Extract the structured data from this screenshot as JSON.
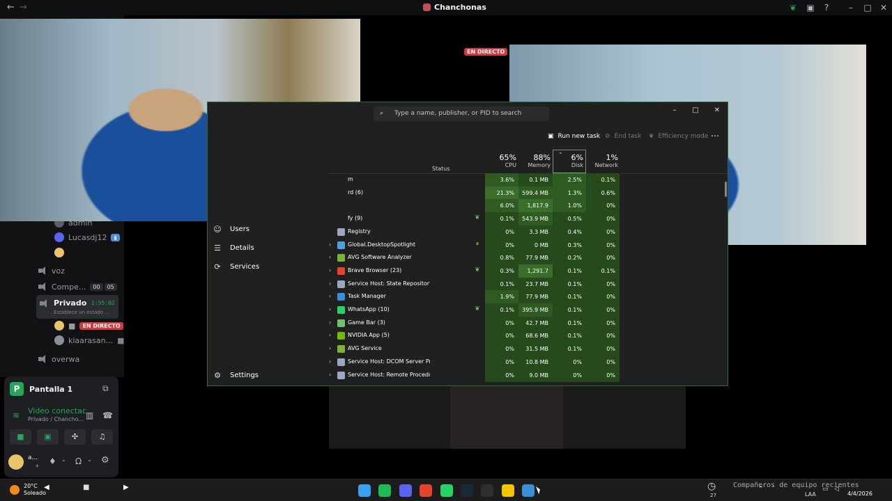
{
  "topbar": {
    "title": "Chanchonas",
    "back_icon": "arrow-left-icon",
    "forward_icon": "arrow-right-icon"
  },
  "channels": {
    "members": [
      {
        "name": "admin"
      },
      {
        "name": "Lucasdj12"
      }
    ],
    "voice_channels": [
      {
        "name": "voz"
      },
      {
        "name": "Compe...",
        "counter_a": "00",
        "counter_b": "05"
      },
      {
        "name": "Privado",
        "timer": "1:55:02",
        "status": "Establece un estado ..."
      },
      {
        "name": "overwa"
      }
    ],
    "privado_members": [
      {
        "name": "",
        "badge": "EN DIRECTO"
      },
      {
        "name": "kiaarasan..."
      }
    ]
  },
  "voice_panel": {
    "logo_letter": "P",
    "title": "Pantalla 1",
    "connection": "Video conectac",
    "location": "Privado / Chancho..."
  },
  "user_bar": {
    "name": "a...",
    "sub": "+"
  },
  "live_badge": "EN DIRECTO",
  "task_manager": {
    "search_placeholder": "Type a name, publisher, or PID to search",
    "commands": {
      "run_new_task": "Run new task",
      "end_task": "End task",
      "efficiency_mode": "Efficiency mode"
    },
    "sidebar": [
      {
        "label": "Users",
        "icon": "users-icon"
      },
      {
        "label": "Details",
        "icon": "list-icon"
      },
      {
        "label": "Services",
        "icon": "services-icon"
      },
      {
        "label": "Settings",
        "icon": "gear-icon"
      }
    ],
    "columns": {
      "status": "Status",
      "cpu": {
        "pct": "65%",
        "label": "CPU"
      },
      "memory": {
        "pct": "88%",
        "label": "Memory"
      },
      "disk": {
        "pct": "6%",
        "label": "Disk"
      },
      "network": {
        "pct": "1%",
        "label": "Network"
      }
    },
    "processes": [
      {
        "name": "m",
        "expand": false,
        "icon_color": "#202020",
        "status": "",
        "cpu": "3.6%",
        "mem": "0.1 MB",
        "disk": "2.5%",
        "net": "0.1%"
      },
      {
        "name": "rd (6)",
        "expand": false,
        "icon_color": "#202020",
        "status": "",
        "cpu": "21.3%",
        "mem": "599.4 MB",
        "disk": "1.3%",
        "net": "0.6%"
      },
      {
        "name": "",
        "expand": false,
        "icon_color": "#202020",
        "status": "",
        "cpu": "6.0%",
        "mem": "1,817.9 MB",
        "disk": "1.0%",
        "net": "0%"
      },
      {
        "name": "fy (9)",
        "expand": false,
        "icon_color": "#202020",
        "status": "leaf",
        "cpu": "0.1%",
        "mem": "543.9 MB",
        "disk": "0.5%",
        "net": "0%"
      },
      {
        "name": "Registry",
        "expand": false,
        "icon_color": "#9aa8c0",
        "status": "",
        "cpu": "0%",
        "mem": "3.3 MB",
        "disk": "0.4%",
        "net": "0%"
      },
      {
        "name": "Global.DesktopSpotlight",
        "expand": true,
        "icon_color": "#4aa3e0",
        "status": "pause",
        "cpu": "0%",
        "mem": "0 MB",
        "disk": "0.3%",
        "net": "0%"
      },
      {
        "name": "AVG Software Analyzer",
        "expand": true,
        "icon_color": "#7bb33a",
        "status": "",
        "cpu": "0.8%",
        "mem": "77.9 MB",
        "disk": "0.2%",
        "net": "0%"
      },
      {
        "name": "Brave Browser (23)",
        "expand": true,
        "icon_color": "#e2452c",
        "status": "leaf",
        "cpu": "0.3%",
        "mem": "1,291.7 MB",
        "disk": "0.1%",
        "net": "0.1%"
      },
      {
        "name": "Service Host: State Repository ...",
        "expand": true,
        "icon_color": "#9aa8c0",
        "status": "",
        "cpu": "0.1%",
        "mem": "23.7 MB",
        "disk": "0.1%",
        "net": "0%"
      },
      {
        "name": "Task Manager",
        "expand": true,
        "icon_color": "#3a8fd9",
        "status": "",
        "cpu": "1.9%",
        "mem": "77.9 MB",
        "disk": "0.1%",
        "net": "0%"
      },
      {
        "name": "WhatsApp (10)",
        "expand": true,
        "icon_color": "#25d366",
        "status": "leaf",
        "cpu": "0.1%",
        "mem": "395.9 MB",
        "disk": "0.1%",
        "net": "0%"
      },
      {
        "name": "Game Bar (3)",
        "expand": true,
        "icon_color": "#6cc36c",
        "status": "",
        "cpu": "0%",
        "mem": "42.7 MB",
        "disk": "0.1%",
        "net": "0%"
      },
      {
        "name": "NVIDIA App (5)",
        "expand": true,
        "icon_color": "#76b900",
        "status": "",
        "cpu": "0%",
        "mem": "68.6 MB",
        "disk": "0.1%",
        "net": "0%"
      },
      {
        "name": "AVG Service",
        "expand": true,
        "icon_color": "#7bb33a",
        "status": "",
        "cpu": "0%",
        "mem": "31.5 MB",
        "disk": "0.1%",
        "net": "0%"
      },
      {
        "name": "Service Host: DCOM Server Pr...",
        "expand": true,
        "icon_color": "#9aa8c0",
        "status": "",
        "cpu": "0%",
        "mem": "10.8 MB",
        "disk": "0%",
        "net": "0%"
      },
      {
        "name": "Service Host: Remote Procedu...",
        "expand": true,
        "icon_color": "#9aa8c0",
        "status": "",
        "cpu": "0%",
        "mem": "9.0 MB",
        "disk": "0%",
        "net": "0%"
      }
    ]
  },
  "taskbar": {
    "temperature": "20°C",
    "condition": "Soleado",
    "notice": "Compañeros de equipo recientes",
    "lang": "LAA",
    "date": "4/4/2026",
    "badge_count": "27",
    "apps": [
      {
        "name": "windows-start-icon",
        "color": "#3aa0f0"
      },
      {
        "name": "spotify-icon",
        "color": "#1db954"
      },
      {
        "name": "discord-icon",
        "color": "#5865f2"
      },
      {
        "name": "brave-icon",
        "color": "#e2452c"
      },
      {
        "name": "whatsapp-icon",
        "color": "#25d366"
      },
      {
        "name": "steam-icon",
        "color": "#1b2838"
      },
      {
        "name": "obs-icon",
        "color": "#302e31"
      },
      {
        "name": "notes-icon",
        "color": "#f5c400"
      },
      {
        "name": "task-manager-icon",
        "color": "#3a8fd9"
      }
    ]
  }
}
